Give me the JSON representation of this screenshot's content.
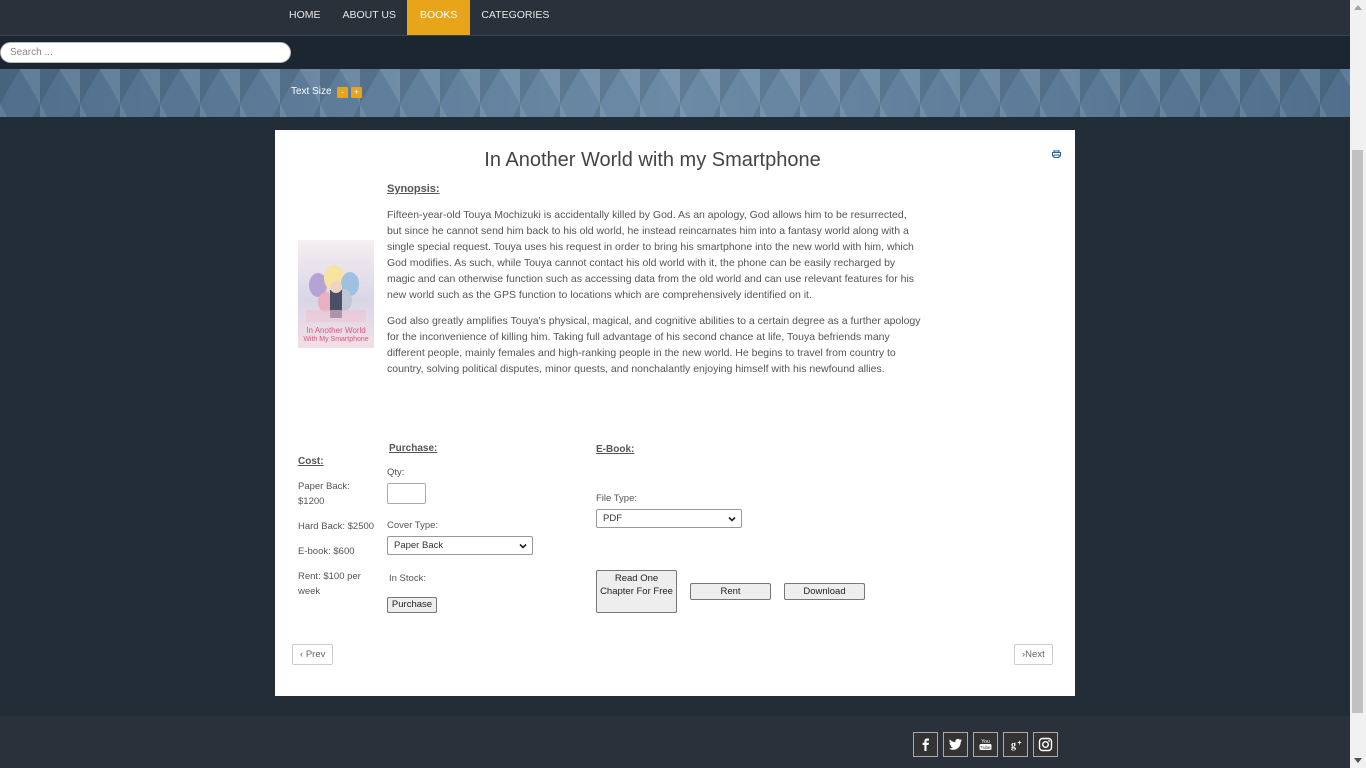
{
  "nav": {
    "items": [
      {
        "label": "HOME"
      },
      {
        "label": "ABOUT US"
      },
      {
        "label": "BOOKS",
        "active": true
      },
      {
        "label": "CATEGORIES"
      }
    ]
  },
  "search": {
    "placeholder": "Search ...",
    "value": ""
  },
  "text_size": {
    "label": "Text Size",
    "decrease": "-",
    "increase": "+"
  },
  "book": {
    "title": "In Another World with my Smartphone",
    "cover_text": "In Another World With My Smartphone",
    "synopsis_heading": "Synopsis:",
    "synopsis_p1": "Fifteen-year-old Touya Mochizuki is accidentally killed by God. As an apology, God allows him to be resurrected, but since he cannot send him back to his old world, he instead reincarnates him into a fantasy world along with a single special request. Touya uses his request in order to bring his smartphone into the new world with him, which God modifies. As such, while Touya cannot contact his old world with it, the phone can be easily recharged by magic and can otherwise function such as accessing data from the old world and can use relevant features for his new world such as the GPS function to locations which are comprehensively identified on it.",
    "synopsis_p2": "God also greatly amplifies Touya's physical, magical, and cognitive abilities to a certain degree as a further apology for the inconvenience of killing him. Taking full advantage of his second chance at life, Touya befriends many different people, mainly females and high-ranking people in the new world. He begins to travel from country to country, solving political disputes, minor quests, and nonchalantly enjoying himself with his newfound allies."
  },
  "cost": {
    "heading": "Cost:",
    "paper_back": "Paper Back: $1200",
    "hard_back": "Hard Back: $2500",
    "ebook": "E-book: $600",
    "rent": "Rent: $100 per week"
  },
  "purchase": {
    "heading": "Purchase:",
    "qty_label": "Qty:",
    "qty_value": "",
    "cover_type_label": "Cover Type:",
    "cover_type_value": "Paper Back",
    "in_stock_label": "In Stock:",
    "purchase_button": "Purchase"
  },
  "ebook": {
    "heading": "E-Book:",
    "file_type_label": "File Type:",
    "file_type_value": "PDF",
    "read_chapter_button": "Read One Chapter For Free",
    "rent_button": "Rent",
    "download_button": "Download"
  },
  "pager": {
    "prev": "Prev",
    "next": "Next"
  },
  "colors": {
    "accent": "#e8a51a",
    "nav_bg": "#2a313b",
    "page_bg": "#222d38"
  },
  "social": [
    "facebook-icon",
    "twitter-icon",
    "youtube-icon",
    "google-plus-icon",
    "instagram-icon"
  ]
}
